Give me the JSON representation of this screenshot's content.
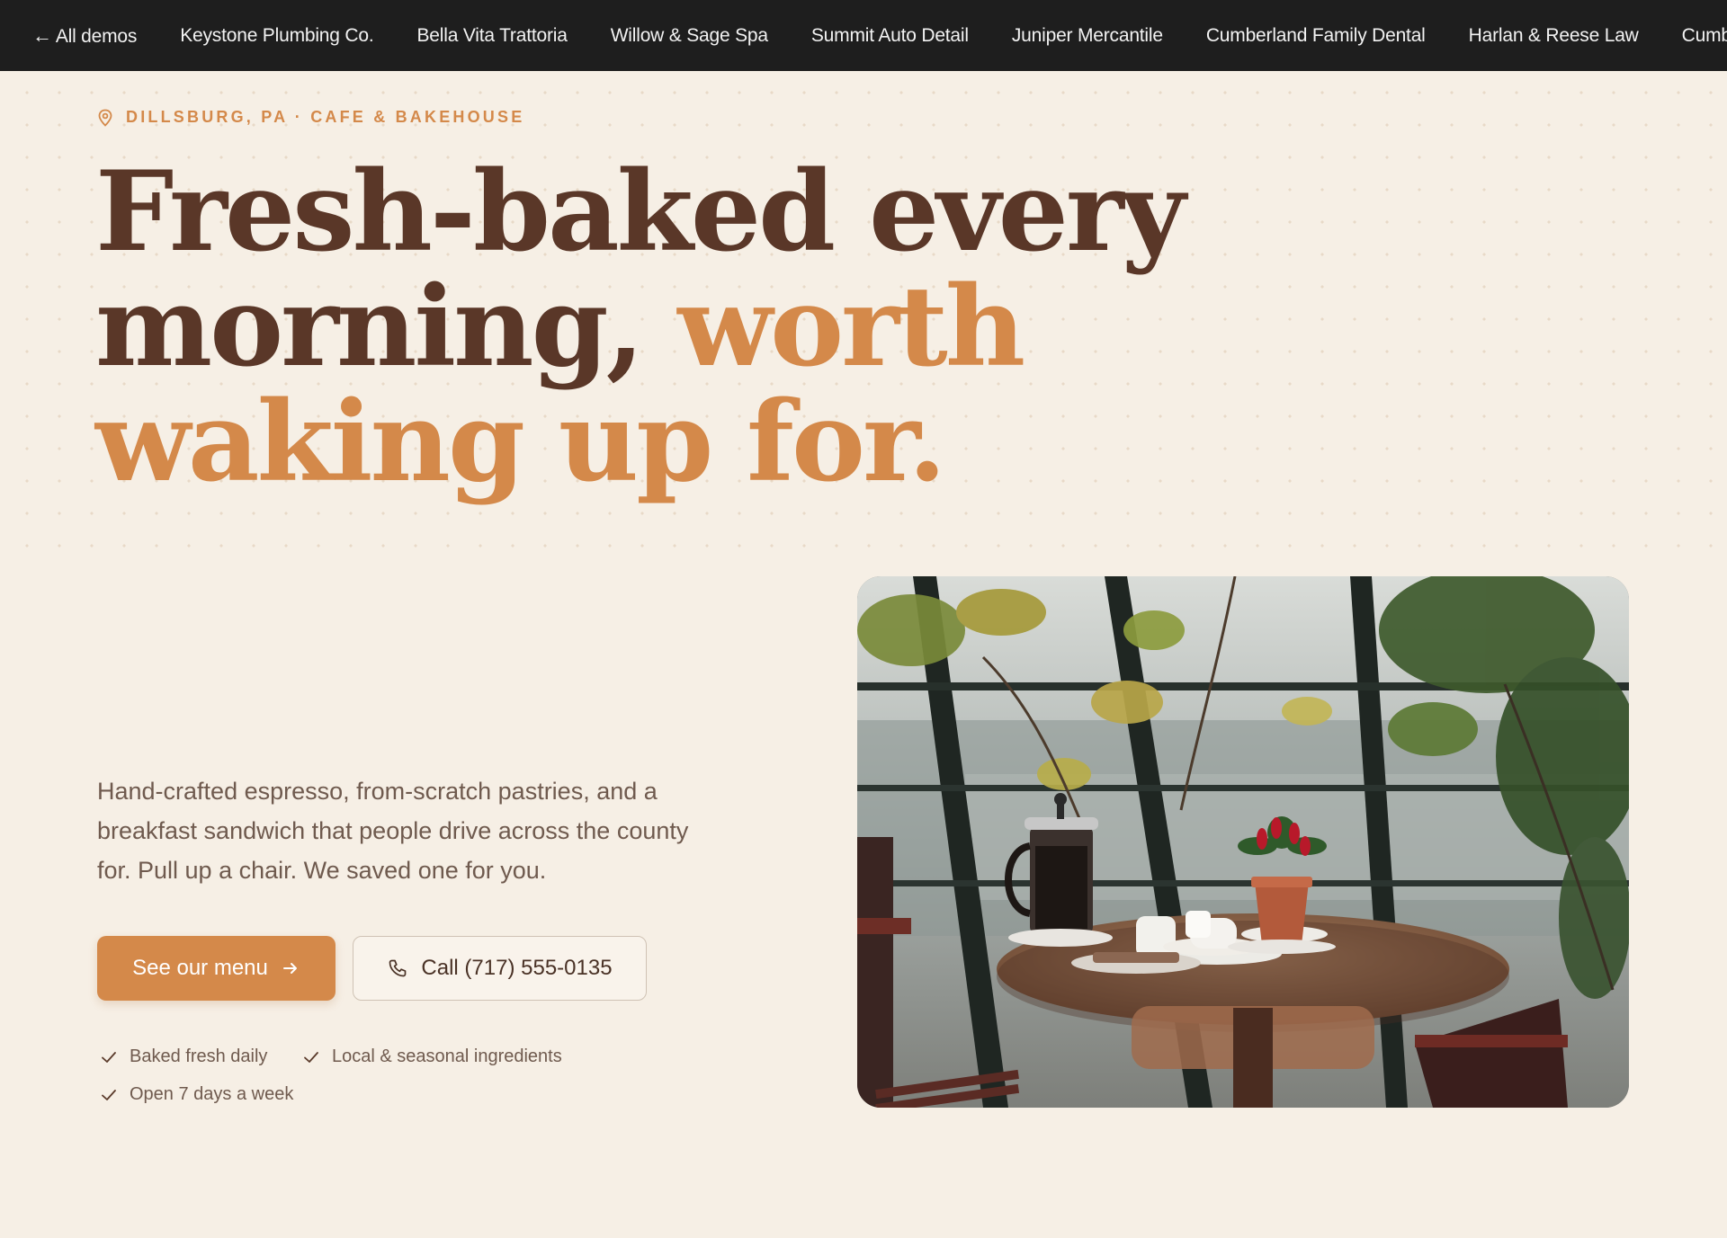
{
  "topbar": {
    "back_label": "All demos",
    "items": [
      "Keystone Plumbing Co.",
      "Bella Vita Trattoria",
      "Willow & Sage Spa",
      "Summit Auto Detail",
      "Juniper Mercantile",
      "Cumberland Family Dental",
      "Harlan & Reese Law",
      "Cumb"
    ]
  },
  "hero": {
    "eyebrow": "DILLSBURG, PA · CAFE & BAKEHOUSE",
    "headline_part1": "Fresh-baked every morning, ",
    "headline_part2": "worth waking up for.",
    "lede": "Hand-crafted espresso, from-scratch pastries, and a breakfast sandwich that people drive across the county for. Pull up a chair. We saved one for you.",
    "primary_cta": "See our menu",
    "secondary_cta": "Call (717) 555-0135",
    "features": [
      "Baked fresh daily",
      "Local & seasonal ingredients",
      "Open 7 days a week"
    ]
  },
  "icons": {
    "location": "map-pin-icon",
    "phone": "phone-icon",
    "arrow": "arrow-right-icon",
    "check": "check-icon",
    "back": "arrow-left-icon"
  },
  "colors": {
    "background": "#f6efe5",
    "topbar": "#1e1e1e",
    "accent": "#d4894a",
    "headline": "#5a3728",
    "body_text": "#6f5a4e"
  }
}
